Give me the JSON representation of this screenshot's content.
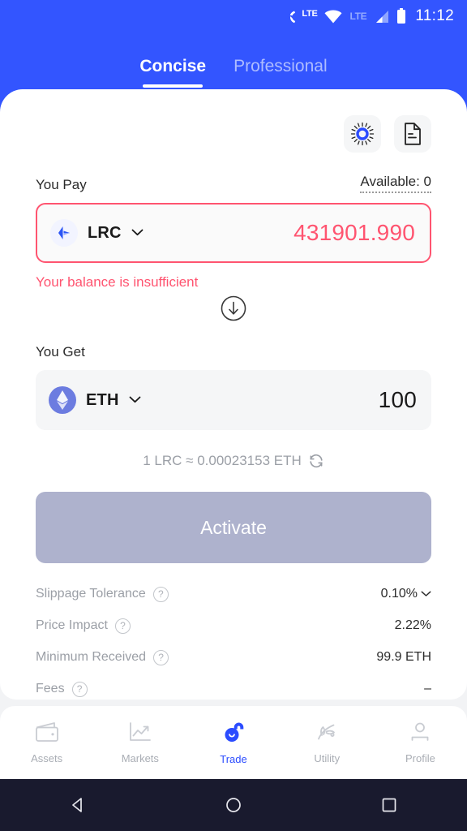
{
  "status_bar": {
    "volte_label": "LTE",
    "network_label": "LTE",
    "time": "11:12"
  },
  "header": {
    "tabs": [
      {
        "label": "Concise",
        "active": true
      },
      {
        "label": "Professional",
        "active": false
      }
    ]
  },
  "card_actions": [
    {
      "name": "loopring-logo-icon",
      "label": "loopring-icon"
    },
    {
      "name": "document-icon",
      "label": "document-icon"
    }
  ],
  "pay": {
    "label": "You Pay",
    "available": "Available: 0",
    "token": "LRC",
    "amount": "431901.990",
    "error": "Your balance is insufficient"
  },
  "swap": {
    "icon": "arrow-down-circle-icon"
  },
  "get": {
    "label": "You Get",
    "token": "ETH",
    "amount": "100"
  },
  "rate": {
    "text": "1 LRC ≈ 0.00023153 ETH",
    "refresh_icon": "refresh-icon"
  },
  "action": {
    "label": "Activate",
    "enabled": false
  },
  "details": [
    {
      "label": "Slippage Tolerance",
      "value": "0.10%",
      "has_chevron": true
    },
    {
      "label": "Price Impact",
      "value": "2.22%",
      "has_chevron": false
    },
    {
      "label": "Minimum Received",
      "value": "99.9 ETH",
      "has_chevron": false
    },
    {
      "label": "Fees",
      "value": "–",
      "has_chevron": false
    }
  ],
  "bottom_nav": [
    {
      "label": "Assets",
      "icon": "wallet-icon",
      "active": false
    },
    {
      "label": "Markets",
      "icon": "chart-icon",
      "active": false
    },
    {
      "label": "Trade",
      "icon": "trade-icon",
      "active": true
    },
    {
      "label": "Utility",
      "icon": "leaf-icon",
      "active": false
    },
    {
      "label": "Profile",
      "icon": "person-icon",
      "active": false
    }
  ],
  "system_nav": [
    {
      "name": "back-button"
    },
    {
      "name": "home-button"
    },
    {
      "name": "recents-button"
    }
  ],
  "colors": {
    "brand_blue": "#3355ff",
    "error_red": "#ff5470",
    "disabled_button": "#aeb2cd",
    "muted_text": "#9b9fa6"
  }
}
